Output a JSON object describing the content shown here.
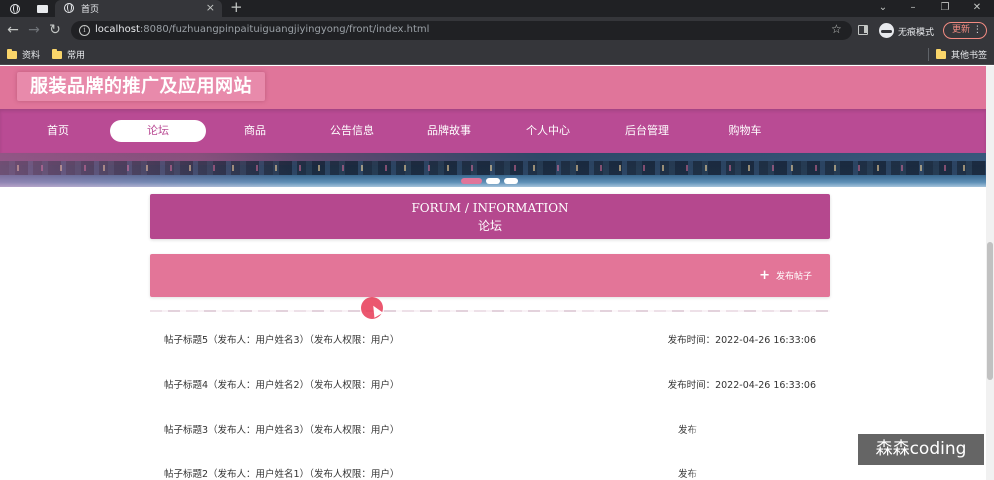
{
  "browser": {
    "active_tab_title": "首页",
    "url_host": "localhost",
    "url_rest": ":8080/fuzhuangpinpaituiguangjiyingyong/front/index.html",
    "incognito_label": "无痕模式",
    "update_label": "更新",
    "bookmarks": [
      "资料",
      "常用"
    ],
    "other_bookmarks": "其他书签"
  },
  "site": {
    "title": "服装品牌的推广及应用网站",
    "nav": [
      "首页",
      "论坛",
      "商品",
      "公告信息",
      "品牌故事",
      "个人中心",
      "后台管理",
      "购物车"
    ],
    "active_nav": "论坛"
  },
  "forum": {
    "heading_en": "FORUM / INFORMATION",
    "heading_cn": "论坛",
    "post_button": "发布帖子",
    "posts": [
      {
        "title": "帖子标题5（发布人：用户姓名3）（发布人权限：用户）",
        "time": "发布时间：2022-04-26 16:33:06"
      },
      {
        "title": "帖子标题4（发布人：用户姓名2）（发布人权限：用户）",
        "time": "发布时间：2022-04-26 16:33:06"
      },
      {
        "title": "帖子标题3（发布人：用户姓名3）（发布人权限：用户）",
        "time": "发布"
      },
      {
        "title": "帖子标题2（发布人：用户姓名1）（发布人权限：用户）",
        "time": "发布"
      }
    ]
  },
  "overlay": {
    "watermark": "森森coding"
  },
  "colors": {
    "header_pink": "#e0759a",
    "nav_magenta": "#b94b94",
    "forum_header": "#b5488e",
    "post_bar": "#e37598"
  }
}
